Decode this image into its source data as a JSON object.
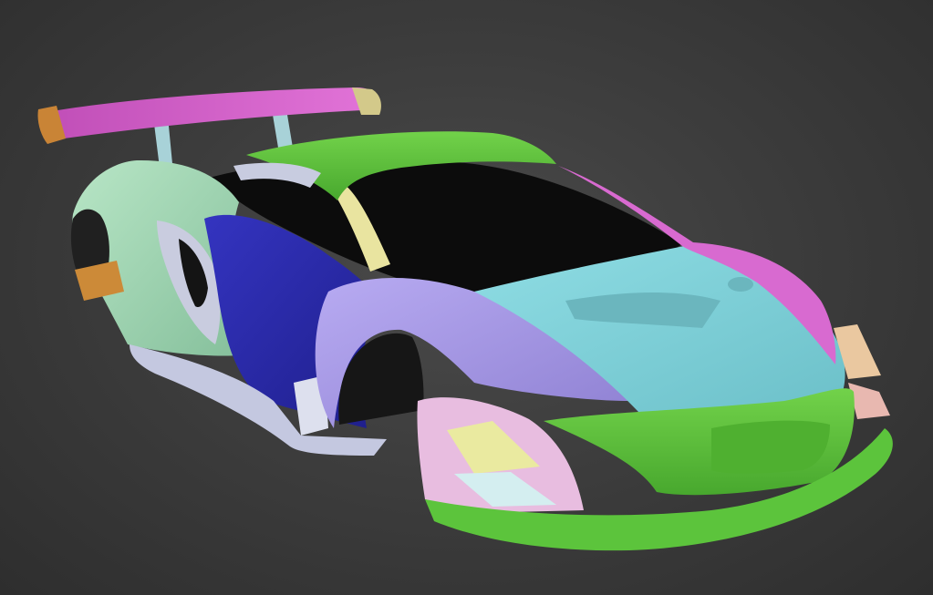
{
  "scene": {
    "subject": "car-body-model",
    "background_color": "#3b3b3b",
    "part_colors": {
      "wing": "#d65fcf",
      "wing_endplate": "#c98436",
      "wing_strut": "#a8d2d8",
      "roof": "#66c43c",
      "rear_fender": "#a6dcb8",
      "side_panel": "#2a2aa8",
      "front_fender": "#a99ae8",
      "hood": "#7fd0d8",
      "front_bumper": "#5cc43c",
      "front_splitter": "#5cc43c",
      "headlight_area": "#d86ad0",
      "front_wheel_arch_insert": "#e8bde0",
      "canard": "#eaeaa0",
      "side_skirt": "#c4c8e0",
      "rear_arch_insert": "#cc8a38",
      "front_corner_flaps": "#eac8a0",
      "a_pillar": "#e9e4a0",
      "window": "#0c0c0c"
    }
  }
}
